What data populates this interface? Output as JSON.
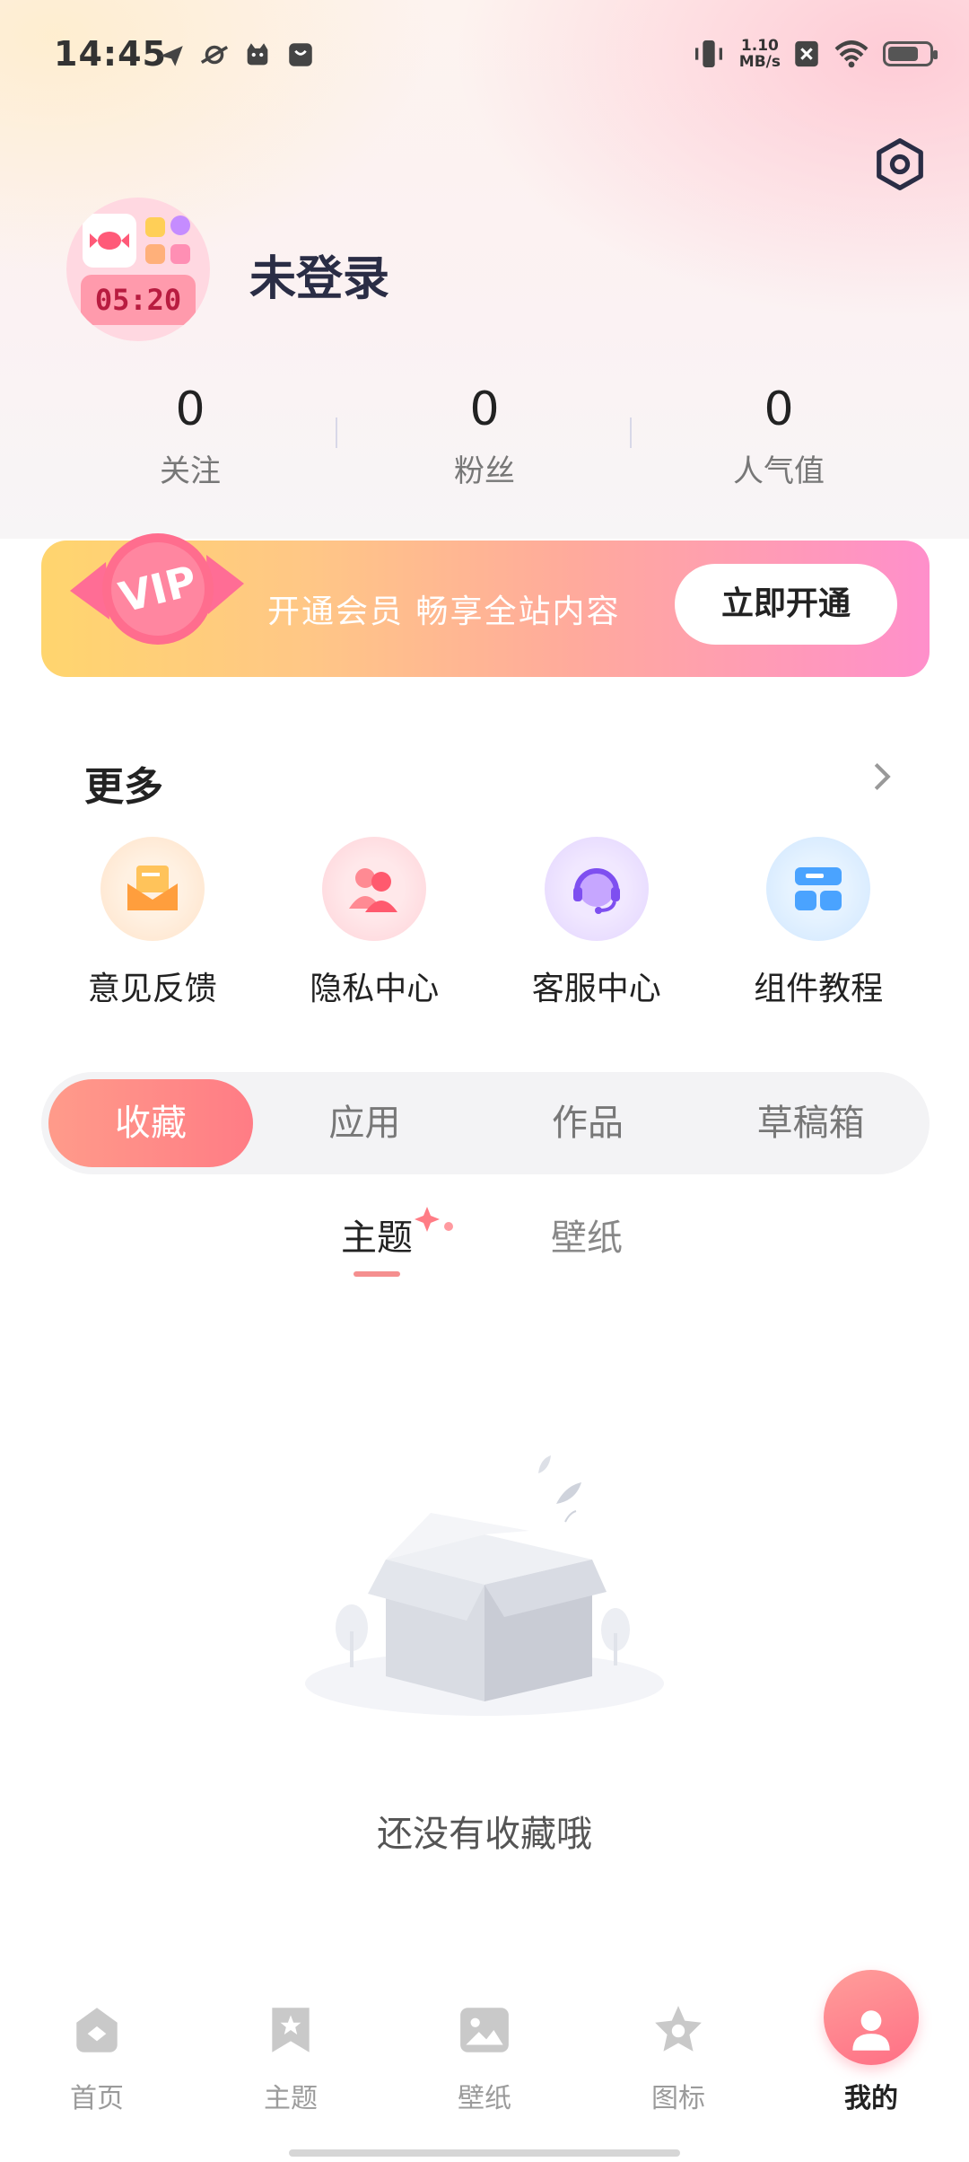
{
  "status_bar": {
    "time": "14:45",
    "net_speed_value": "1.10",
    "net_speed_unit": "MB/s",
    "battery_level": 0.75
  },
  "profile": {
    "username": "未登录",
    "avatar_clock": "05:20"
  },
  "stats": [
    {
      "value": "0",
      "label": "关注"
    },
    {
      "value": "0",
      "label": "粉丝"
    },
    {
      "value": "0",
      "label": "人气值"
    }
  ],
  "vip": {
    "badge": "VIP",
    "text": "开通会员 畅享全站内容",
    "button": "立即开通"
  },
  "more": {
    "title": "更多",
    "items": [
      {
        "label": "意见反馈",
        "icon": "feedback-envelope-icon"
      },
      {
        "label": "隐私中心",
        "icon": "privacy-users-icon"
      },
      {
        "label": "客服中心",
        "icon": "headset-icon"
      },
      {
        "label": "组件教程",
        "icon": "widgets-icon"
      }
    ]
  },
  "tabs": [
    {
      "label": "收藏",
      "active": true
    },
    {
      "label": "应用",
      "active": false
    },
    {
      "label": "作品",
      "active": false
    },
    {
      "label": "草稿箱",
      "active": false
    }
  ],
  "subtabs": [
    {
      "label": "主题",
      "active": true
    },
    {
      "label": "壁纸",
      "active": false
    }
  ],
  "empty_state": {
    "text": "还没有收藏哦"
  },
  "bottom_nav": [
    {
      "label": "首页",
      "icon": "home-icon"
    },
    {
      "label": "主题",
      "icon": "theme-bookmark-icon"
    },
    {
      "label": "壁纸",
      "icon": "wallpaper-image-icon"
    },
    {
      "label": "图标",
      "icon": "icon-star-icon"
    },
    {
      "label": "我的",
      "icon": "profile-icon",
      "active": true
    }
  ],
  "colors": {
    "accent": "#ff7c85",
    "vip_gradient_start": "#ffd56e",
    "vip_gradient_end": "#ff8fcb",
    "nav_inactive": "#9b9b9b"
  }
}
